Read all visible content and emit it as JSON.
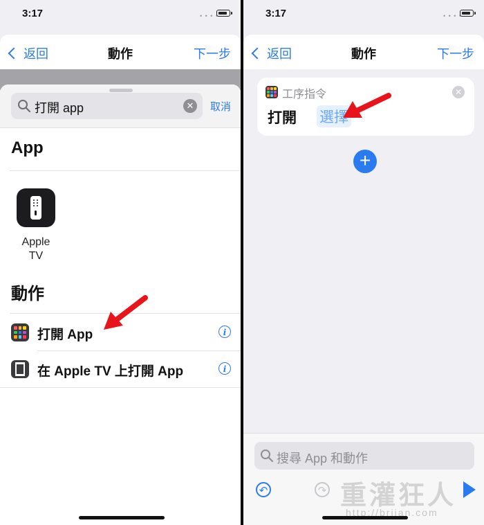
{
  "left": {
    "status": {
      "time": "3:17"
    },
    "nav": {
      "back": "返回",
      "title": "動作",
      "next": "下一步"
    },
    "search": {
      "value": "打開 app",
      "cancel": "取消"
    },
    "sections": {
      "apps": "App",
      "actions": "動作"
    },
    "apps": [
      {
        "name": "Apple TV",
        "label": "Apple\nTV",
        "icon": "apple-tv-remote-icon"
      }
    ],
    "actions": [
      {
        "label": "打開 App",
        "icon": "app-grid-icon"
      },
      {
        "label": "在 Apple TV 上打開 App",
        "icon": "film-icon"
      }
    ]
  },
  "right": {
    "status": {
      "time": "3:17"
    },
    "nav": {
      "back": "返回",
      "title": "動作",
      "next": "下一步"
    },
    "card": {
      "caption": "工序指令",
      "verb": "打開",
      "parameter": "選擇"
    },
    "search": {
      "placeholder": "搜尋 App 和動作"
    },
    "watermark": {
      "title": "重灌狂人",
      "url": "http://briian.com"
    }
  },
  "colors": {
    "accent": "#2a7bef",
    "arrow": "#e8141b",
    "background": "#efeff4"
  }
}
